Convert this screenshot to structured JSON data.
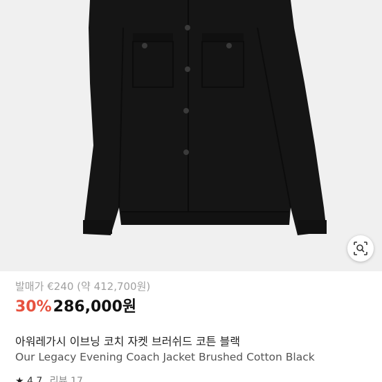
{
  "product": {
    "original_price_label": "발매가",
    "original_price": "€240",
    "original_price_converted": "(약 412,700원)",
    "discount": "30%",
    "sale_price": "286,000원",
    "title_ko": "아워레가시 이브닝 코치 자켓 브러쉬드 코튼 블랙",
    "title_en": "Our Legacy Evening Coach Jacket Brushed Cotton Black",
    "rating": "4.7",
    "reviews_label": "리뷰 17"
  },
  "icons": {
    "lens": "image-search-icon",
    "star": "star-icon"
  },
  "colors": {
    "discount": "#e7523f",
    "background": "#f0f0f0",
    "jacket": "#151515"
  }
}
